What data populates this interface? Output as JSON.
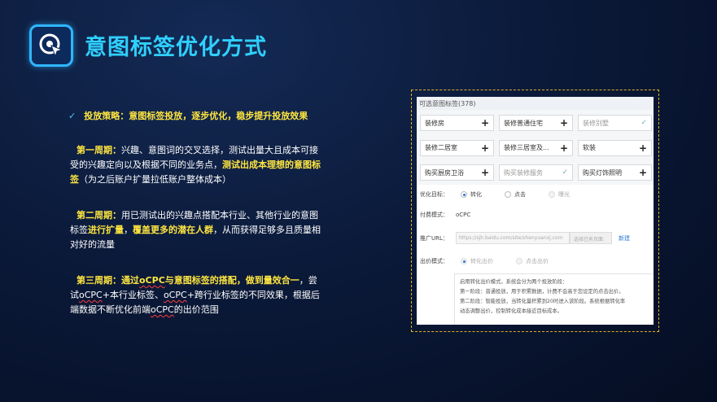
{
  "header": {
    "title": "意图标签优化方式",
    "icon": "target-cursor-icon",
    "accent": "#2fd0ff"
  },
  "strategy": {
    "check": "✓",
    "text": "投放策略：意图标签投放，逐步优化，稳步提升投放效果"
  },
  "phase1": {
    "label": "第一周期：",
    "text1": "兴趣、意图词的交叉选择，测试出量大且成本可接受的兴趣定向以及根据不同的业务点，",
    "highlight": "测试出成本理想的意图标签",
    "text2": "（为之后账户扩量拉低账户整体成本）"
  },
  "phase2": {
    "label": "第二周期：",
    "text1": "用已测试出的兴趣点搭配本行业、其他行业的意图标签",
    "highlight1": "进行扩量",
    "comma": "，",
    "highlight2": "覆盖更多的潜在人群",
    "text2": "，从而获得足够多且质量相对好的流量"
  },
  "phase3": {
    "label": "第三周期：通过",
    "kw1": "oCPC",
    "label2": "与意图标签的搭配，做到量效合一",
    "text1": "，尝试",
    "kw2": "oCPC",
    "text2": "+本行业标签、",
    "kw3": "oCPC",
    "text3": "+跨行业标签的不同效果，根据后端数据不断优化前端",
    "kw4": "oCPC",
    "text4": "的出价范围"
  },
  "panel": {
    "available_header": "可选意图标签(378)",
    "tags": [
      {
        "label": "装修房",
        "sign": "+",
        "added": false
      },
      {
        "label": "装修普通住宅",
        "sign": "+",
        "added": false
      },
      {
        "label": "装修别墅",
        "sign": "✓",
        "added": true
      },
      {
        "label": "装修二居室",
        "sign": "+",
        "added": false
      },
      {
        "label": "装修三居室及...",
        "sign": "+",
        "added": false
      },
      {
        "label": "软装",
        "sign": "+",
        "added": false
      },
      {
        "label": "购买厨房卫浴",
        "sign": "+",
        "added": false
      },
      {
        "label": "购买装修服务",
        "sign": "✓",
        "added": true
      },
      {
        "label": "购买灯饰照明",
        "sign": "+",
        "added": false
      }
    ],
    "goal_label": "优化目标：",
    "goal_options": [
      "转化",
      "点击",
      "曝光"
    ],
    "bill_label": "付费模式：",
    "bill_value": "oCPC",
    "url_label": "推广URL：",
    "url_value": "https://sjh.baidu.com/site/shenyuanxj.com",
    "url_select": "选择已有页面",
    "url_link": "新建",
    "bid_label": "出价模式：",
    "bid_options": [
      "转化出价",
      "点击出价"
    ],
    "desc_lines": [
      "启用转化出价模式，系统会分为两个投放阶段：",
      "第一阶段：普通投放，用于积累数据，计费不会高于您设定的点击出价。",
      "第二阶段：智能投放，当转化量积累到20时进入该阶段。系统根据转化率",
      "动态调整出价，控制转化成本接近目标成本。"
    ]
  }
}
